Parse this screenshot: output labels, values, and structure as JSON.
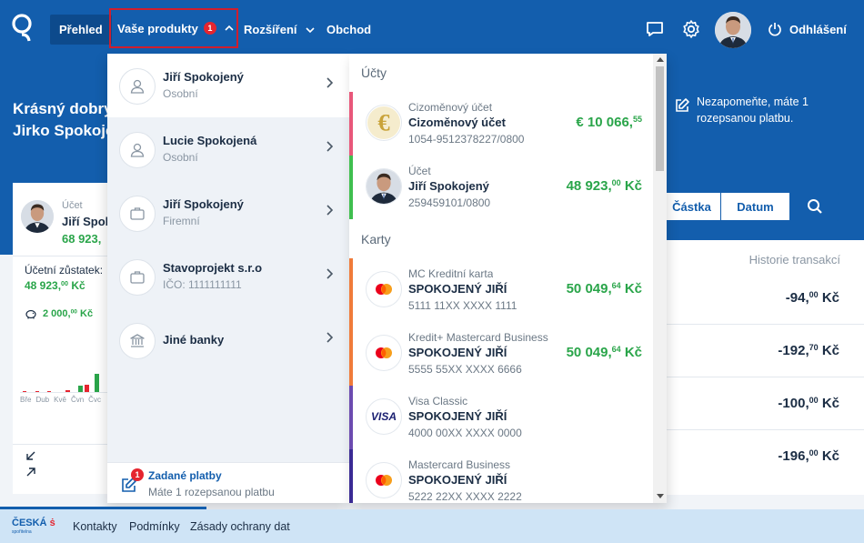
{
  "nav": {
    "prehled": "Přehled",
    "produkty": "Vaše produkty",
    "produkty_badge": "1",
    "rozsireni": "Rozšíření",
    "obchod": "Obchod",
    "logout": "Odhlášení"
  },
  "hero": {
    "greeting_line1": "Krásný dobrý",
    "greeting_line2": "Jirko Spokoje",
    "notice": "Nezapomeňte, máte 1 rozepsanou platbu."
  },
  "left_card": {
    "type": "Účet",
    "name": "Jiří Spok",
    "amount": "68 923,",
    "balance_label": "Účetní zůstatek:",
    "balance_main": "48 923,",
    "balance_dec": "00",
    "balance_cur": "Kč",
    "savings_main": "2 000,",
    "savings_dec": "00",
    "savings_cur": "Kč",
    "months": [
      "Bře",
      "Dub",
      "Kvě",
      "Čvn",
      "Čvc"
    ]
  },
  "search": {
    "castka": "Částka",
    "datum": "Datum"
  },
  "history": {
    "label": "Historie transakcí",
    "transactions": [
      {
        "main": "-94,",
        "dec": "00",
        "cur": "Kč"
      },
      {
        "main": "-192,",
        "dec": "70",
        "cur": "Kč"
      },
      {
        "main": "-100,",
        "dec": "00",
        "cur": "Kč"
      },
      {
        "main": "-196,",
        "dec": "00",
        "cur": "Kč"
      }
    ]
  },
  "dropdown": {
    "clients": [
      {
        "title": "Jiří Spokojený",
        "sub": "Osobní",
        "icon": "person-icon"
      },
      {
        "title": "Lucie Spokojená",
        "sub": "Osobní",
        "icon": "person-icon"
      },
      {
        "title": "Jiří Spokojený",
        "sub": "Firemní",
        "icon": "briefcase-icon"
      },
      {
        "title": "Stavoprojekt s.r.o",
        "sub": "IČO: 1111111111",
        "icon": "briefcase-icon"
      },
      {
        "title": "Jiné banky",
        "sub": "",
        "icon": "bank-icon"
      }
    ],
    "footer_badge": "1",
    "footer_title": "Zadané platby",
    "footer_sub": "Máte 1 rozepsanou platbu",
    "section_accounts": "Účty",
    "section_cards": "Karty",
    "accounts": [
      {
        "type": "Cizoměnový účet",
        "name": "Cizoměnový účet",
        "number": "1054-9512378227/0800",
        "amount_main": "€ 10 066,",
        "amount_dec": "55",
        "amount_cur": "",
        "color": "#e8577a",
        "icon": "euro-icon"
      },
      {
        "type": "Účet",
        "name": "Jiří Spokojený",
        "number": "259459101/0800",
        "amount_main": "48 923,",
        "amount_dec": "00",
        "amount_cur": " Kč",
        "color": "#3fbf4f",
        "icon": "avatar"
      }
    ],
    "cards": [
      {
        "type": "MC Kreditní karta",
        "name": "SPOKOJENÝ JIŘÍ",
        "number": "5111 11XX XXXX 1111",
        "amount_main": "50 049,",
        "amount_dec": "64",
        "amount_cur": " Kč",
        "color": "#f07b3a",
        "icon": "mastercard-icon"
      },
      {
        "type": "Kredit+ Mastercard Business",
        "name": "SPOKOJENÝ JIŘÍ",
        "number": "5555 55XX XXXX 6666",
        "amount_main": "50 049,",
        "amount_dec": "64",
        "amount_cur": " Kč",
        "color": "#f07b3a",
        "icon": "mastercard-icon"
      },
      {
        "type": "Visa Classic",
        "name": "SPOKOJENÝ JIŘÍ",
        "number": "4000 00XX XXXX 0000",
        "amount_main": "",
        "amount_dec": "",
        "amount_cur": "",
        "color": "#6c4bb0",
        "icon": "visa-icon",
        "visa_text": "VISA"
      },
      {
        "type": "Mastercard Business",
        "name": "SPOKOJENÝ JIŘÍ",
        "number": "5222 22XX XXXX 2222",
        "amount_main": "",
        "amount_dec": "",
        "amount_cur": "",
        "color": "#3a2a94",
        "icon": "mastercard-icon"
      }
    ]
  },
  "footer": {
    "logo_main": "ČESKÁ",
    "logo_sub": "spořitelna",
    "links": [
      "Kontakty",
      "Podmínky",
      "Zásady ochrany dat"
    ]
  }
}
